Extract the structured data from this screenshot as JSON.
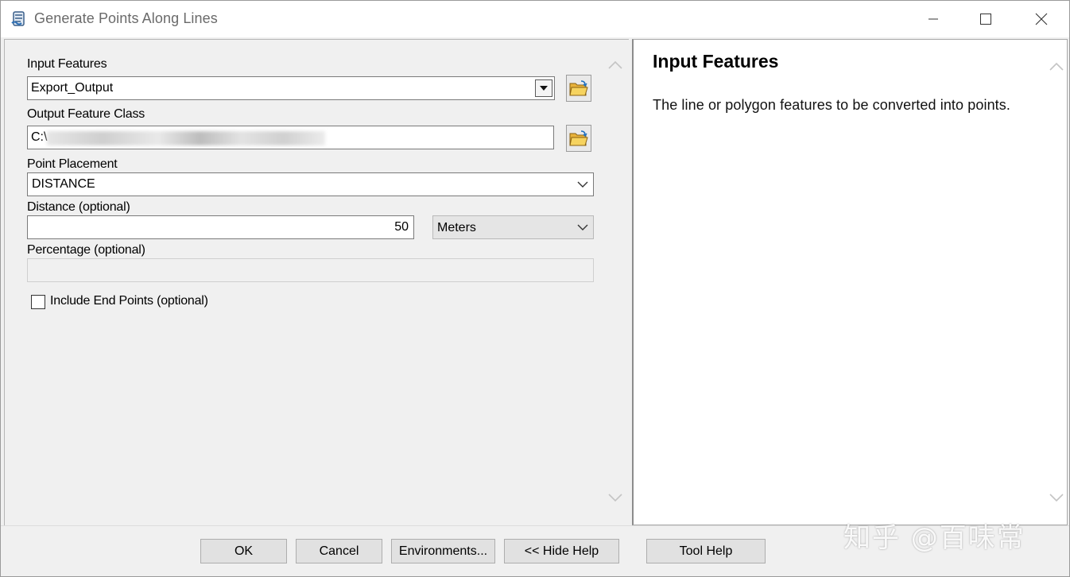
{
  "window": {
    "title": "Generate Points Along Lines"
  },
  "form": {
    "input_features": {
      "label": "Input Features",
      "value": "Export_Output"
    },
    "output_feature_class": {
      "label": "Output Feature Class",
      "value_prefix": "C:\\"
    },
    "point_placement": {
      "label": "Point Placement",
      "value": "DISTANCE"
    },
    "distance": {
      "label": "Distance (optional)",
      "value": "50",
      "units": "Meters"
    },
    "percentage": {
      "label": "Percentage (optional)",
      "value": ""
    },
    "include_end_points": {
      "label": "Include End Points (optional)",
      "checked": false
    }
  },
  "help": {
    "title": "Input Features",
    "body": "The line or polygon features to be converted into points."
  },
  "buttons": {
    "ok": "OK",
    "cancel": "Cancel",
    "environments": "Environments...",
    "hide_help": "<< Hide Help",
    "tool_help": "Tool Help"
  },
  "watermark": "知乎 @百味常",
  "icons": {
    "app": "script-tool-icon",
    "folder": "open-folder-icon"
  }
}
